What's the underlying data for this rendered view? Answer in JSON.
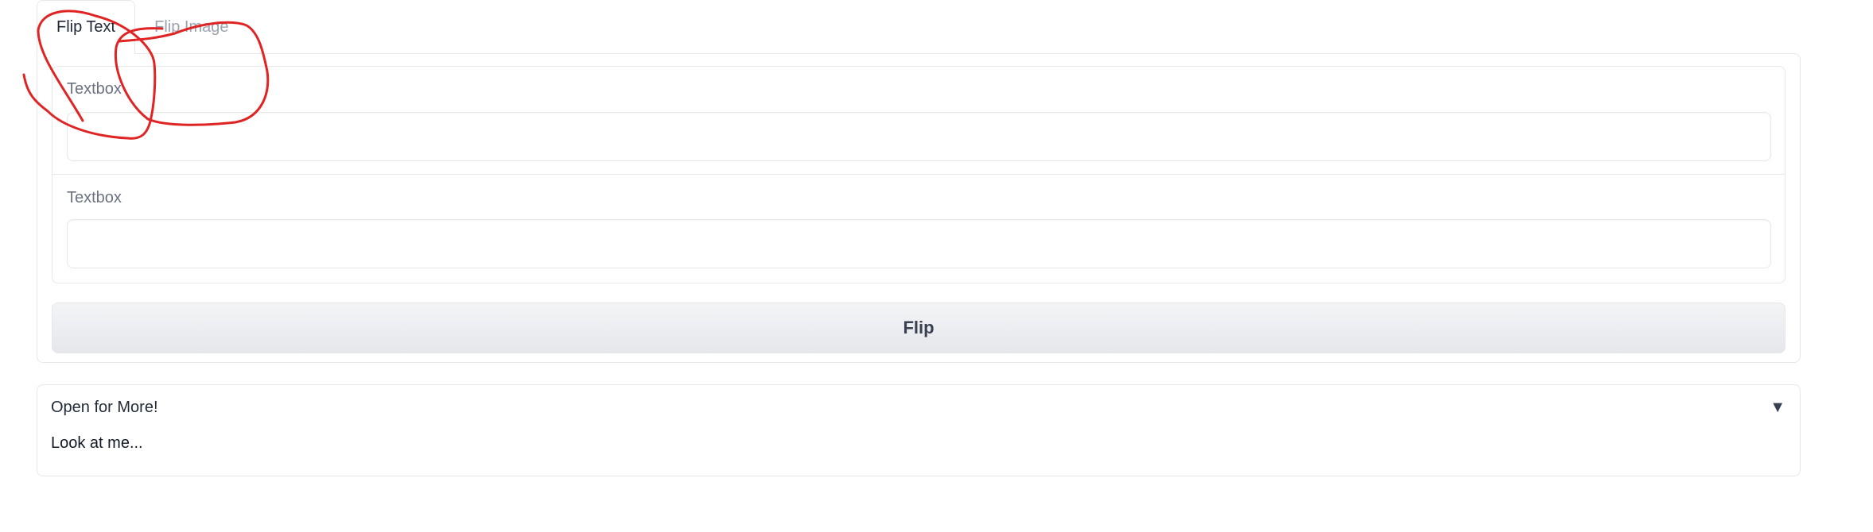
{
  "tabs": [
    {
      "label": "Flip Text",
      "active": true
    },
    {
      "label": "Flip Image",
      "active": false
    }
  ],
  "form": {
    "textbox1": {
      "label": "Textbox",
      "value": "",
      "placeholder": ""
    },
    "textbox2": {
      "label": "Textbox",
      "value": "",
      "placeholder": ""
    },
    "submit_label": "Flip"
  },
  "accordion": {
    "title": "Open for More!",
    "toggle_icon": "▼",
    "content": "Look at me..."
  },
  "colors": {
    "annotation": "#e02424",
    "border": "#e5e7eb",
    "inactive_tab": "#9ca3af"
  }
}
